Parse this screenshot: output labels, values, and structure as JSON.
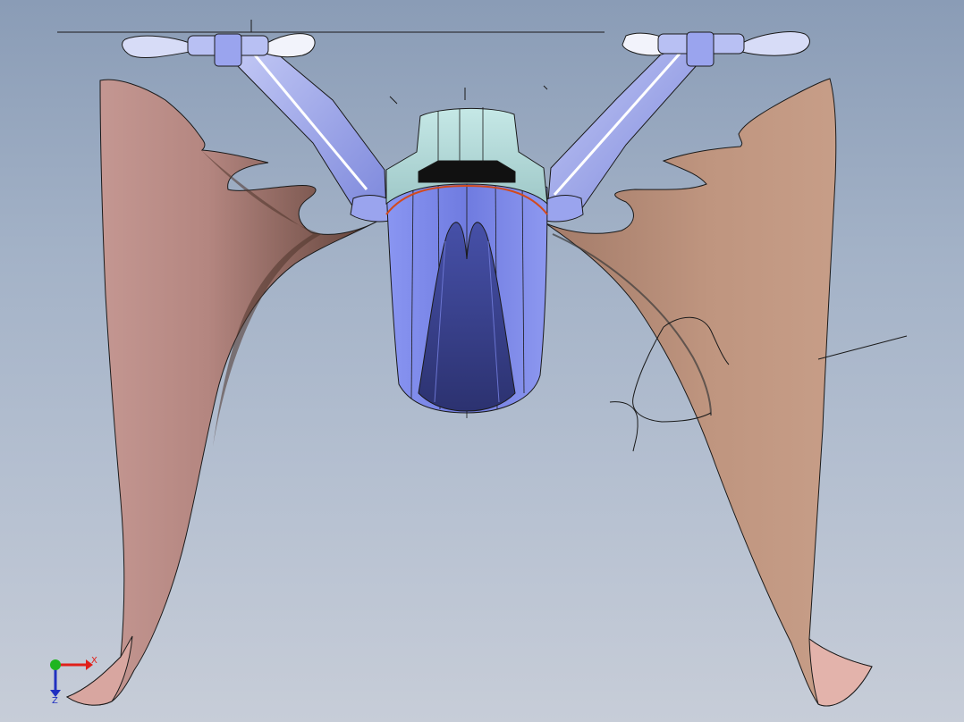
{
  "viewport": {
    "background_top": "#8a9cb6",
    "background_bottom": "#c7cdd8"
  },
  "model": {
    "wing_color": "#c49a88",
    "wing_shadow": "#5c3f38",
    "wing_highlight": "#e3b8ac",
    "body_color": "#7b86e8",
    "body_dark": "#3a418a",
    "cockpit_color": "#b4dad8",
    "arm_color": "#aab3f0",
    "propeller_color": "#dfe3fa",
    "edge_color": "#1a1a1a",
    "trim_color": "#d24a1e"
  },
  "triad": {
    "x_label": "X",
    "z_label": "Z",
    "x_color": "#e0201a",
    "y_color": "#1fb51f",
    "z_color": "#2030c0"
  }
}
